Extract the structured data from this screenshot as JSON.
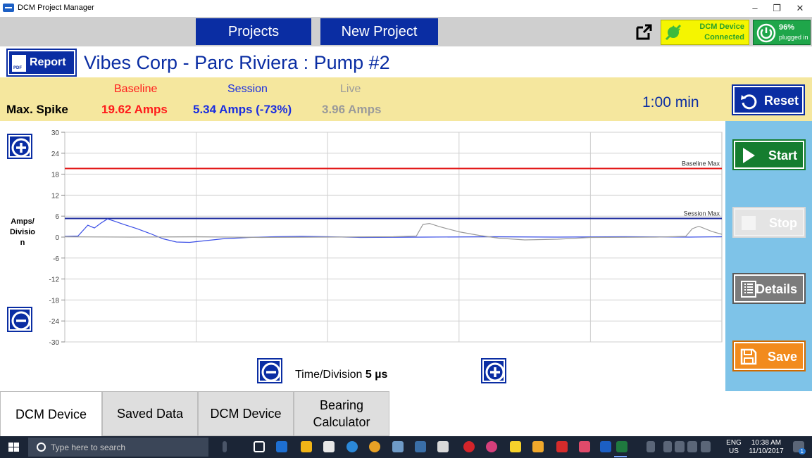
{
  "window": {
    "title": "DCM Project Manager",
    "minimize_glyph": "–",
    "restore_glyph": "❐",
    "close_glyph": "✕"
  },
  "topnav": {
    "projects_label": "Projects",
    "new_project_label": "New Project",
    "external_icon": "external-link-icon",
    "device_status_line1": "DCM Device",
    "device_status_line2": "Connected",
    "battery_pct": "96%",
    "battery_status": "plugged in"
  },
  "header": {
    "report_label": "Report",
    "pdf_text": "PDF",
    "title": "Vibes Corp - Parc Riviera : Pump #2"
  },
  "spike": {
    "label": "Max. Spike",
    "baseline_head": "Baseline",
    "session_head": "Session",
    "live_head": "Live",
    "baseline_value": "19.62 Amps",
    "session_value": "5.34 Amps (-73%)",
    "live_value": "3.96 Amps",
    "timer": "1:00 min",
    "reset_label": "Reset",
    "colors": {
      "baseline": "#ff1a1a",
      "session": "#1a2ee0",
      "live": "#9a9a9a"
    }
  },
  "chart_data": {
    "type": "line",
    "ylim": [
      -30,
      30
    ],
    "y_ticks": [
      "30",
      "24",
      "18",
      "12",
      "6",
      "0",
      "-6",
      "-12",
      "-18",
      "-24",
      "-30"
    ],
    "y_tick_values": [
      30,
      24,
      18,
      12,
      6,
      0,
      -6,
      -12,
      -18,
      -24,
      -30
    ],
    "x_divisions": 5,
    "xlim": [
      0,
      1
    ],
    "ylabel": "Amps/ Divisio n",
    "reference_lines": [
      {
        "name": "Baseline Max",
        "value": 19.62,
        "color": "#e31a1a"
      },
      {
        "name": "Session Max",
        "value": 5.34,
        "color": "#1f2d9e"
      }
    ],
    "series": [
      {
        "color": "#3b4fe6",
        "x": [
          0,
          0.02,
          0.035,
          0.045,
          0.055,
          0.065,
          0.075,
          0.09,
          0.11,
          0.13,
          0.15,
          0.17,
          0.19,
          0.21,
          0.24,
          0.28,
          0.32,
          0.36,
          0.4,
          0.45,
          0.55,
          0.65,
          0.75,
          0.85,
          0.95,
          1.0
        ],
        "y": [
          0.2,
          0.3,
          3.4,
          2.6,
          4.0,
          5.2,
          4.6,
          3.6,
          2.4,
          1.0,
          -0.5,
          -1.4,
          -1.5,
          -1.1,
          -0.5,
          -0.1,
          0.1,
          0.2,
          0.1,
          -0.1,
          0.0,
          0.1,
          0.0,
          0.1,
          0.0,
          0.1
        ]
      },
      {
        "color": "#9a9a9a",
        "x": [
          0,
          0.1,
          0.2,
          0.3,
          0.4,
          0.5,
          0.535,
          0.545,
          0.555,
          0.57,
          0.6,
          0.63,
          0.66,
          0.7,
          0.75,
          0.8,
          0.9,
          0.945,
          0.955,
          0.965,
          0.985,
          1.0
        ],
        "y": [
          0.1,
          0.0,
          0.1,
          -0.1,
          0.0,
          0.1,
          0.3,
          3.6,
          3.9,
          3.0,
          1.5,
          0.5,
          -0.3,
          -0.8,
          -0.6,
          -0.1,
          0.0,
          0.2,
          2.4,
          3.1,
          1.6,
          0.8
        ]
      }
    ]
  },
  "timediv": {
    "label": "Time/Division",
    "value": "5 µs"
  },
  "side": {
    "start_label": "Start",
    "stop_label": "Stop",
    "details_label": "Details",
    "save_label": "Save"
  },
  "tabs": [
    {
      "label": "DCM Device"
    },
    {
      "label": "Saved Data"
    },
    {
      "label": "DCM Device"
    },
    {
      "label": "Bearing Calculator"
    }
  ],
  "taskbar": {
    "search_placeholder": "Type here to search",
    "lang_line1": "ENG",
    "lang_line2": "US",
    "time": "10:38 AM",
    "date": "11/10/2017",
    "notification_count": "1"
  }
}
